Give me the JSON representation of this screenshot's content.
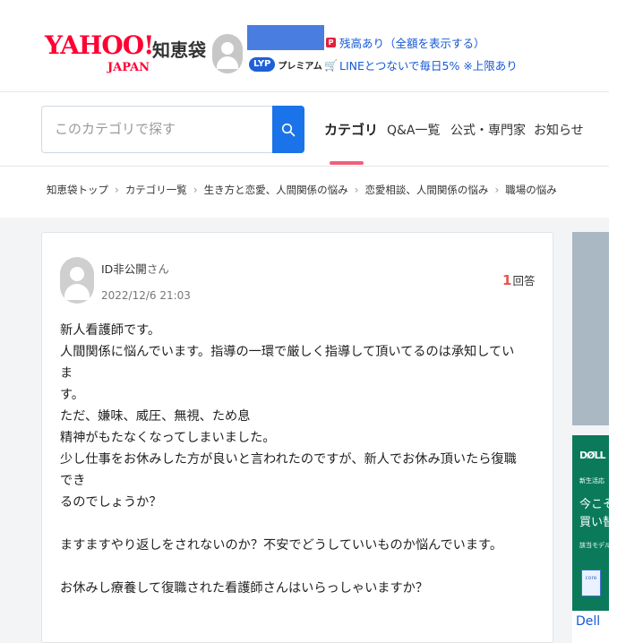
{
  "header": {
    "logo_yahoo": "YAHOO!",
    "logo_japan": "JAPAN",
    "logo_service": "知恵袋",
    "lyp_pill": "LYP",
    "lyp_label": "プレミアム",
    "promo_balance": "残高あり（全額を表示する）",
    "promo_line": "LINEとつないで毎日5% ※上限あり",
    "promo_icons": [
      "paypay-icon",
      "cart-icon"
    ]
  },
  "search": {
    "placeholder": "このカテゴリで探す",
    "nav": [
      "カテゴリ",
      "Q&A一覧",
      "公式・専門家",
      "お知らせ"
    ],
    "active_nav": "カテゴリ"
  },
  "breadcrumb": [
    "知恵袋トップ",
    "カテゴリ一覧",
    "生き方と恋愛、人間関係の悩み",
    "恋愛相談、人間関係の悩み",
    "職場の悩み"
  ],
  "question": {
    "user": "ID非公開",
    "user_suffix": "さん",
    "date": "2022/12/6 21:03",
    "answer_count": "1",
    "answer_label": "回答",
    "lines": [
      "新人看護師です。",
      "人間関係に悩んでいます。指導の一環で厳しく指導して頂いてるのは承知していま",
      "す。",
      "ただ、嫌味、威圧、無視、ため息",
      "精神がもたなくなってしまいました。",
      "少し仕事をお休みした方が良いと言われたのですが、新人でお休み頂いたら復職でき",
      "るのでしょうか？",
      "",
      "ますますやり返しをされないのか？不安でどうしていいものか悩んでいます。",
      "",
      "お休みし療養して復職された看護師さんはいらっしゃいますか？"
    ]
  },
  "ad": {
    "brand": "DØLL",
    "line1": "新生活応",
    "line2": "今こそ",
    "line3": "買い替",
    "line4": "該当モデル",
    "chip": "core",
    "footer": "Dell"
  },
  "colors": {
    "yahoo_red": "#ff0033",
    "link_blue": "#1558d6",
    "search_blue": "#1a73e8",
    "nav_underline": "#f0607a",
    "answer_count_red": "#e8554a",
    "dell_green": "#0b7a5a"
  }
}
